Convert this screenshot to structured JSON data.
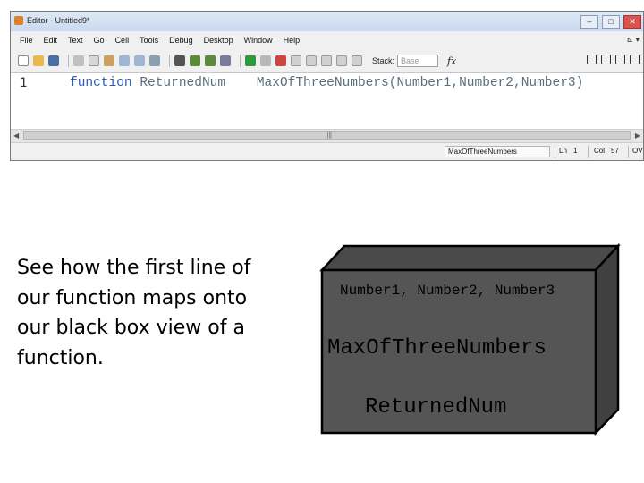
{
  "editor": {
    "title": "Editor - Untitled9*",
    "window_buttons": [
      "–",
      "□",
      "✕"
    ],
    "menu": [
      "File",
      "Edit",
      "Text",
      "Go",
      "Cell",
      "Tools",
      "Debug",
      "Desktop",
      "Window",
      "Help"
    ],
    "menu_right": "⊾ ▾",
    "toolbar": {
      "stack_label": "Stack:",
      "stack_value": "Base",
      "fx_label": "fx"
    },
    "code": {
      "line_number": "1",
      "keyword": "function",
      "rest": " ReturnedNum    MaxOfThreeNumbers(Number1,Number2,Number3)"
    },
    "scroll_grip": "|||",
    "status": {
      "function_name": "MaxOfThreeNumbers",
      "ln_label": "Ln",
      "ln_value": "1",
      "col_label": "Col",
      "col_value": "57",
      "mode": "OVR"
    }
  },
  "slide": {
    "caption": "See how the first line of our function maps onto our black box view of a function."
  },
  "black_box": {
    "inputs": "Number1, Number2, Number3",
    "name": "MaxOfThreeNumbers",
    "output": "ReturnedNum",
    "colors": {
      "front": "#555555",
      "side": "#404040",
      "top": "#4a4a4a",
      "edge": "#000000"
    }
  }
}
